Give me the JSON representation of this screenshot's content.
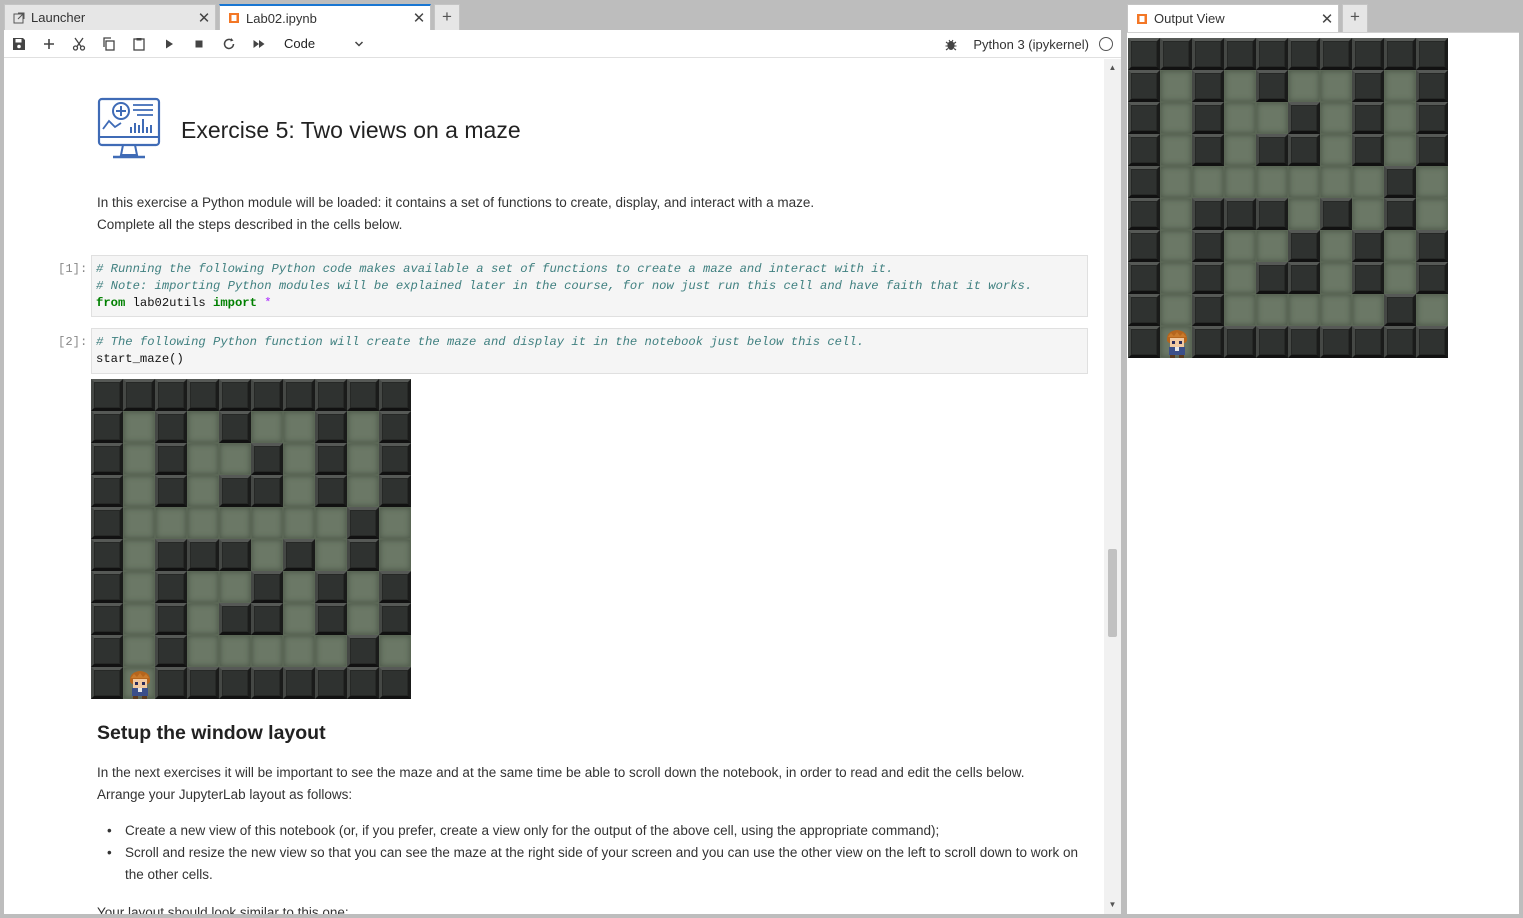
{
  "left_tabs": {
    "launcher": "Launcher",
    "notebook": "Lab02.ipynb"
  },
  "right_tabs": {
    "output": "Output View"
  },
  "toolbar": {
    "cell_type": "Code",
    "kernel_name": "Python 3 (ipykernel)"
  },
  "notebook": {
    "title": "Exercise 5: Two views on a maze",
    "intro_line1": "In this exercise a Python module will be loaded: it contains a set of functions to create, display, and interact with a maze.",
    "intro_line2": "Complete all the steps described in the cells below.",
    "cell1": {
      "prompt": "[1]:",
      "comment1": "# Running the following Python code makes available a set of functions to create a maze and interact with it.",
      "comment2": "# Note: importing Python modules will be explained later in the course, for now just run this cell and have faith that it works.",
      "kw_from": "from",
      "module": " lab02utils ",
      "kw_import": "import",
      "star": " *"
    },
    "cell2": {
      "prompt": "[2]:",
      "comment": "# The following Python function will create the maze and display it in the notebook just below this cell.",
      "code": "start_maze()"
    },
    "section_title": "Setup the window layout",
    "para2_line1": "In the next exercises it will be important to see the maze and at the same time be able to scroll down the notebook, in order to read and edit the cells below.",
    "para2_line2": "Arrange your JupyterLab layout as follows:",
    "bullets": [
      "Create a new view of this notebook (or, if you prefer, create a view only for the output of the above cell, using the appropriate command);",
      "Scroll and resize the new view so that you can see the maze at the right side of your screen and you can use the other view on the left to scroll down to work on the other cells."
    ],
    "cutoff_line": "Your layout should look similar to this one:"
  },
  "maze": {
    "rows": [
      "##########",
      "#.#.#..#.#",
      "#.#..#.#.#",
      "#.#.##.#.#",
      "#.......#.",
      "#.###.#.#.",
      "#.#..#.#.#",
      "#.#.##.#.#",
      "#.#.....#.",
      "#H########"
    ],
    "legend": "# = wall, . = floor, H = player"
  },
  "colors": {
    "accent": "#1976d2",
    "background_gray": "#bdbdbd",
    "tab_icon_orange": "#f37726"
  }
}
